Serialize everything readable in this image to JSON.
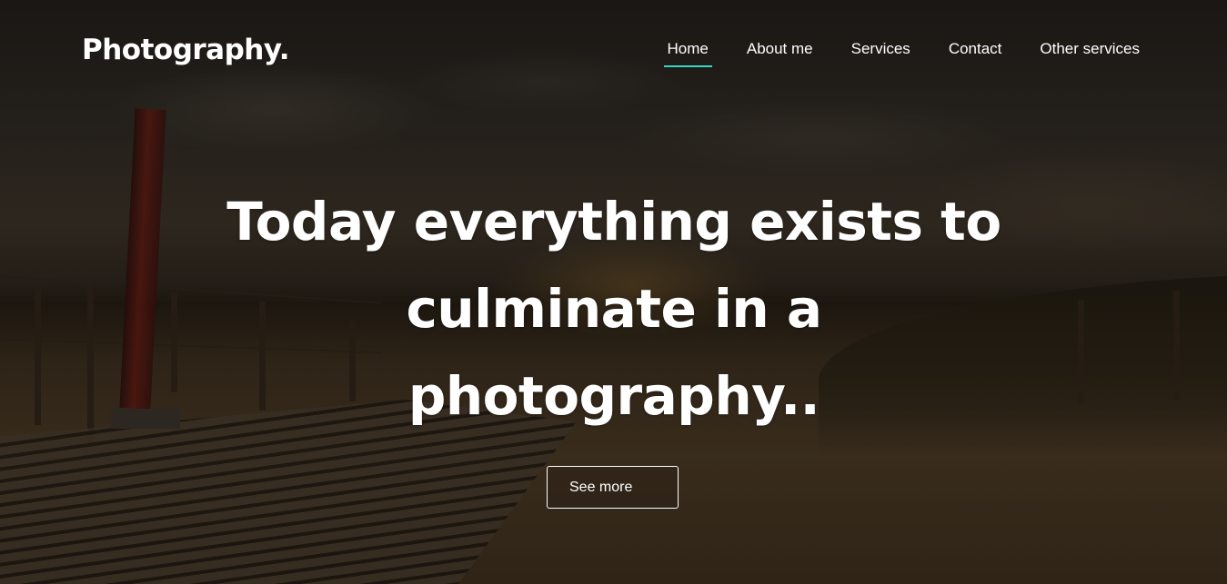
{
  "brand": {
    "logo_text": "Photography."
  },
  "nav": {
    "items": [
      {
        "label": "Home",
        "active": true
      },
      {
        "label": "About me",
        "active": false
      },
      {
        "label": "Services",
        "active": false
      },
      {
        "label": "Contact",
        "active": false
      },
      {
        "label": "Other services",
        "active": false
      }
    ],
    "active_underline_color": "#37d6c6"
  },
  "hero": {
    "headline_lines": [
      "Today everything exists to",
      "culminate in a",
      "photography.."
    ],
    "cta_label": "See more",
    "background_image": "sunset-beach-boardwalk"
  }
}
